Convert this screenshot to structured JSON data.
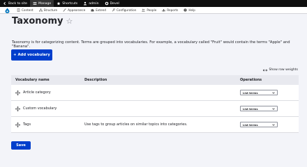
{
  "toolbar": {
    "items": [
      {
        "label": "Back to site",
        "icon": "arrow-left-icon"
      },
      {
        "label": "Manage",
        "icon": "hamburger-icon"
      },
      {
        "label": "Shortcuts",
        "icon": "star-icon"
      },
      {
        "label": "admin",
        "icon": "user-icon"
      },
      {
        "label": "Devel",
        "icon": "gear-icon"
      }
    ]
  },
  "tray": {
    "items": [
      {
        "label": "Content"
      },
      {
        "label": "Structure"
      },
      {
        "label": "Appearance"
      },
      {
        "label": "Extend"
      },
      {
        "label": "Configuration"
      },
      {
        "label": "People"
      },
      {
        "label": "Reports"
      },
      {
        "label": "Help"
      }
    ]
  },
  "page": {
    "title": "Taxonomy",
    "description": "Taxonomy is for categorizing content. Terms are grouped into vocabularies. For example, a vocabulary called \"Fruit\" would contain the terms \"Apple\" and \"Banana\".",
    "add_button": "+ Add vocabulary",
    "row_weights": "Show row weights",
    "save_button": "Save"
  },
  "table": {
    "headers": [
      "Vocabulary name",
      "Description",
      "Operations"
    ],
    "rows": [
      {
        "name": "Article category",
        "description": "",
        "operation": "List terms"
      },
      {
        "name": "Custom vocabulary",
        "description": "",
        "operation": "List terms"
      },
      {
        "name": "Tags",
        "description": "Use tags to group articles on similar topics into categories.",
        "operation": "List terms"
      }
    ]
  },
  "colors": {
    "accent": "#003ecc",
    "toolbar": "#0f0f0f"
  }
}
